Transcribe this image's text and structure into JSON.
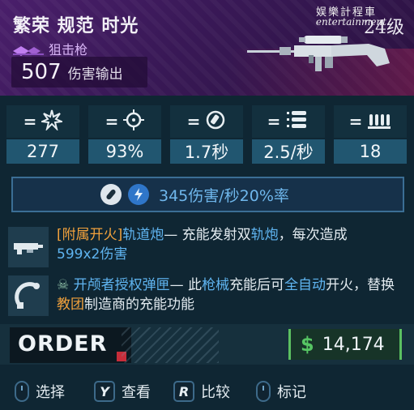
{
  "header": {
    "title": "繁荣 规范 时光",
    "level": "24级",
    "watermark_cn": "娱樂計程車",
    "watermark_en": "entertainment",
    "rarity_label": "狙击枪",
    "damage_value": "507",
    "damage_label": "伤害输出",
    "colors": {
      "accent_purple": "#4a1f6b",
      "rarity_text": "#d7b4f5"
    }
  },
  "stats": [
    {
      "icon": "burst-icon",
      "prefix": "=",
      "value": "277"
    },
    {
      "icon": "crosshair-icon",
      "prefix": "=",
      "value": "93%"
    },
    {
      "icon": "reload-icon",
      "prefix": "=",
      "value": "1.7秒"
    },
    {
      "icon": "fire-rate-icon",
      "prefix": "=",
      "value": "2.5/秒"
    },
    {
      "icon": "magazine-icon",
      "prefix": "=",
      "value": "18"
    }
  ],
  "dps": {
    "text": "345伤害/秒20%率",
    "icons": [
      "ammo-element-icon",
      "shock-icon"
    ]
  },
  "perks": [
    {
      "icon": "underbarrel-railgun-icon",
      "tag": "[附属开火]",
      "name": "轨道炮",
      "desc_1": "— 充能发射双",
      "desc_kw": "轨炮",
      "desc_2": "，每次造成",
      "desc_3": "599x2伤害"
    },
    {
      "icon": "licensed-part-icon",
      "name": "开颅者授权弹匣",
      "desc_1": "— 此",
      "kw_1": "枪械",
      "desc_2": "充能后可",
      "kw_2": "全自动",
      "desc_3": "开火，替换",
      "kw_3": "教团",
      "desc_4": "制造商的充能功能"
    }
  ],
  "manufacturer": {
    "name": "ORDER",
    "colors": {
      "mark": "#c72d3a"
    }
  },
  "price": {
    "symbol": "$",
    "amount": "14,174",
    "color": "#56c463"
  },
  "controls": [
    {
      "type": "mouse",
      "key": "",
      "label": "选择"
    },
    {
      "type": "key",
      "key": "Y",
      "label": "查看"
    },
    {
      "type": "key",
      "key": "R",
      "label": "比较"
    },
    {
      "type": "mouse",
      "key": "",
      "label": "标记"
    }
  ]
}
